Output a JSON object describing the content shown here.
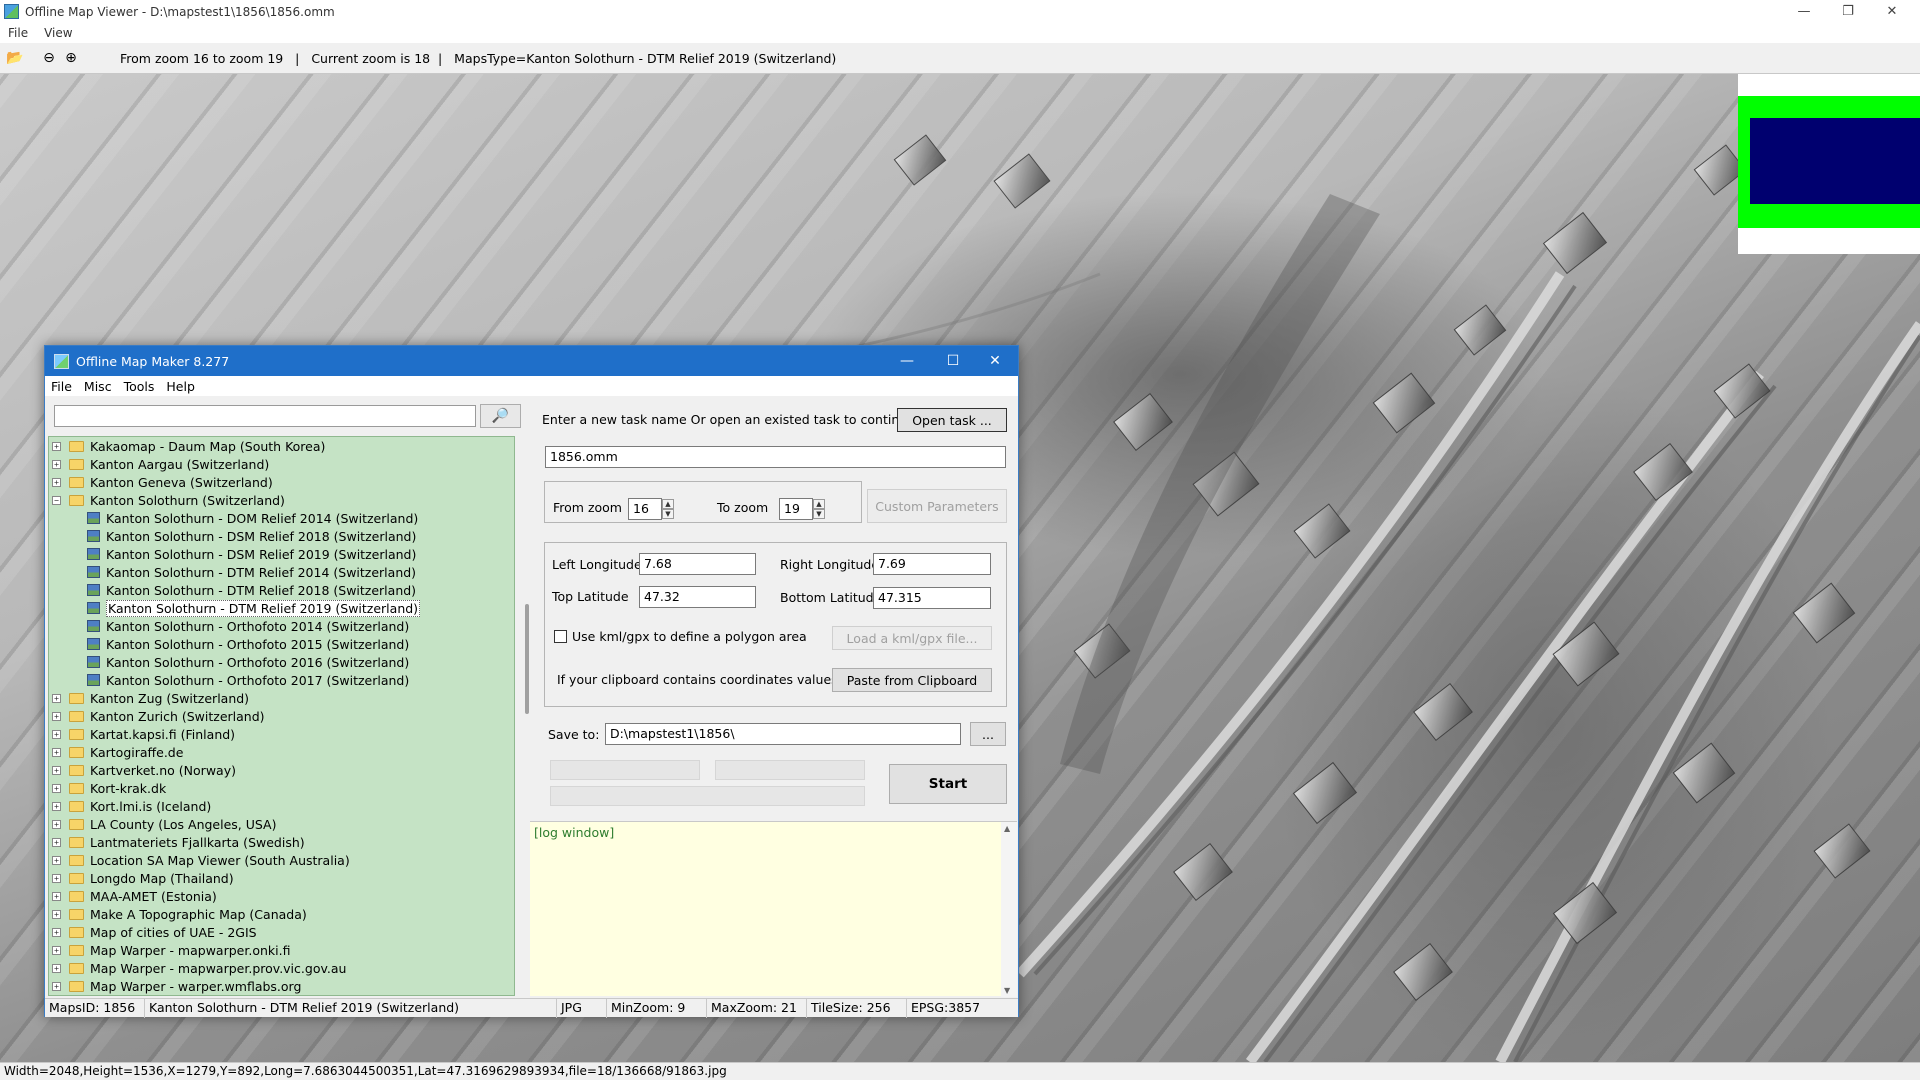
{
  "viewer": {
    "title": "Offline Map Viewer - D:\\mapstest1\\1856\\1856.omm",
    "menu": [
      "File",
      "View"
    ],
    "toolbar_status": "From zoom 16 to zoom 19   |   Current zoom is 18  |   MapsType=Kanton Solothurn - DTM Relief 2019 (Switzerland)",
    "statusbar": "Width=2048,Height=1536,X=1279,Y=892,Long=7.6863044500351,Lat=47.3169629893934,file=18/136668/91863.jpg"
  },
  "dialog": {
    "title": "Offline Map Maker 8.277",
    "menu": [
      "File",
      "Misc",
      "Tools",
      "Help"
    ],
    "search": {
      "value": "",
      "placeholder": ""
    },
    "tree": [
      {
        "label": "Kakaomap - Daum Map (South Korea)",
        "level": 0,
        "kind": "folder",
        "expanded": false
      },
      {
        "label": "Kanton Aargau (Switzerland)",
        "level": 0,
        "kind": "folder",
        "expanded": false
      },
      {
        "label": "Kanton Geneva (Switzerland)",
        "level": 0,
        "kind": "folder",
        "expanded": false
      },
      {
        "label": "Kanton Solothurn (Switzerland)",
        "level": 0,
        "kind": "folder",
        "expanded": true
      },
      {
        "label": "Kanton Solothurn - DOM Relief 2014 (Switzerland)",
        "level": 1,
        "kind": "map"
      },
      {
        "label": "Kanton Solothurn - DSM Relief 2018 (Switzerland)",
        "level": 1,
        "kind": "map"
      },
      {
        "label": "Kanton Solothurn - DSM Relief 2019 (Switzerland)",
        "level": 1,
        "kind": "map"
      },
      {
        "label": "Kanton Solothurn - DTM Relief 2014 (Switzerland)",
        "level": 1,
        "kind": "map"
      },
      {
        "label": "Kanton Solothurn - DTM Relief 2018 (Switzerland)",
        "level": 1,
        "kind": "map"
      },
      {
        "label": "Kanton Solothurn - DTM Relief 2019 (Switzerland)",
        "level": 1,
        "kind": "map",
        "selected": true
      },
      {
        "label": "Kanton Solothurn - Orthofoto 2014 (Switzerland)",
        "level": 1,
        "kind": "map"
      },
      {
        "label": "Kanton Solothurn - Orthofoto 2015 (Switzerland)",
        "level": 1,
        "kind": "map"
      },
      {
        "label": "Kanton Solothurn - Orthofoto 2016 (Switzerland)",
        "level": 1,
        "kind": "map"
      },
      {
        "label": "Kanton Solothurn - Orthofoto 2017 (Switzerland)",
        "level": 1,
        "kind": "map"
      },
      {
        "label": "Kanton Zug (Switzerland)",
        "level": 0,
        "kind": "folder",
        "expanded": false
      },
      {
        "label": "Kanton Zurich (Switzerland)",
        "level": 0,
        "kind": "folder",
        "expanded": false
      },
      {
        "label": "Kartat.kapsi.fi (Finland)",
        "level": 0,
        "kind": "folder",
        "expanded": false
      },
      {
        "label": "Kartogiraffe.de",
        "level": 0,
        "kind": "folder",
        "expanded": false
      },
      {
        "label": "Kartverket.no (Norway)",
        "level": 0,
        "kind": "folder",
        "expanded": false
      },
      {
        "label": "Kort-krak.dk",
        "level": 0,
        "kind": "folder",
        "expanded": false
      },
      {
        "label": "Kort.lmi.is (Iceland)",
        "level": 0,
        "kind": "folder",
        "expanded": false
      },
      {
        "label": "LA County (Los Angeles, USA)",
        "level": 0,
        "kind": "folder",
        "expanded": false
      },
      {
        "label": "Lantmateriets Fjallkarta (Swedish)",
        "level": 0,
        "kind": "folder",
        "expanded": false
      },
      {
        "label": "Location SA Map Viewer (South Australia)",
        "level": 0,
        "kind": "folder",
        "expanded": false
      },
      {
        "label": "Longdo Map (Thailand)",
        "level": 0,
        "kind": "folder",
        "expanded": false
      },
      {
        "label": "MAA-AMET (Estonia)",
        "level": 0,
        "kind": "folder",
        "expanded": false
      },
      {
        "label": "Make A Topographic Map (Canada)",
        "level": 0,
        "kind": "folder",
        "expanded": false
      },
      {
        "label": "Map of cities of UAE - 2GIS",
        "level": 0,
        "kind": "folder",
        "expanded": false
      },
      {
        "label": "Map Warper - mapwarper.onki.fi",
        "level": 0,
        "kind": "folder",
        "expanded": false
      },
      {
        "label": "Map Warper - mapwarper.prov.vic.gov.au",
        "level": 0,
        "kind": "folder",
        "expanded": false
      },
      {
        "label": "Map Warper - warper.wmflabs.org",
        "level": 0,
        "kind": "folder",
        "expanded": false
      }
    ],
    "task_prompt": "Enter a new task name Or open an existed task to continue:",
    "open_task_label": "Open task ...",
    "task_name": "1856.omm",
    "from_zoom_label": "From zoom",
    "from_zoom": "16",
    "to_zoom_label": "To zoom",
    "to_zoom": "19",
    "custom_params_label": "Custom Parameters",
    "left_lon_label": "Left Longitude",
    "left_lon": "7.68",
    "right_lon_label": "Right Longitude",
    "right_lon": "7.69",
    "top_lat_label": "Top Latitude",
    "top_lat": "47.32",
    "bottom_lat_label": "Bottom Latitude",
    "bottom_lat": "47.315",
    "kml_check_label": "Use kml/gpx to define a polygon area",
    "load_kml_label": "Load a kml/gpx file...",
    "clipboard_prompt": "If your clipboard contains coordinates values:",
    "paste_label": "Paste from Clipboard",
    "save_to_label": "Save to:",
    "save_to": "D:\\mapstest1\\1856\\",
    "browse_label": "...",
    "start_label": "Start",
    "log_text": "[log window]",
    "status": {
      "maps_id": "MapsID: 1856",
      "map_name": "Kanton Solothurn - DTM Relief 2019 (Switzerland)",
      "format": "JPG",
      "min_zoom": "MinZoom: 9",
      "max_zoom": "MaxZoom: 21",
      "tile_size": "TileSize: 256",
      "epsg": "EPSG:3857"
    }
  }
}
